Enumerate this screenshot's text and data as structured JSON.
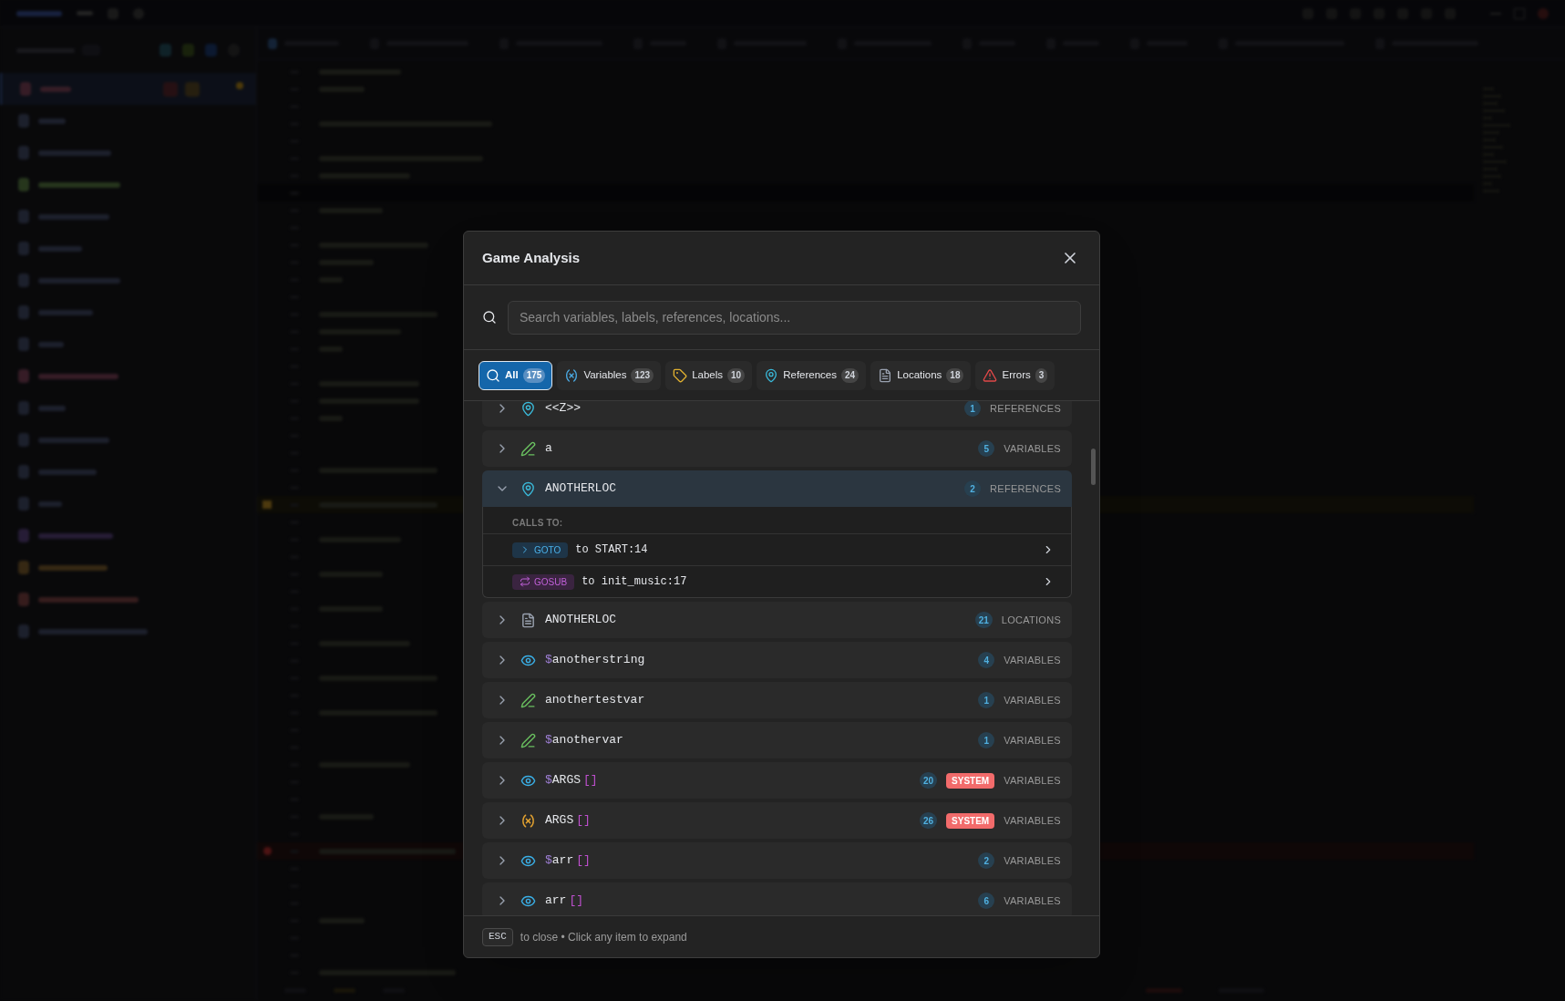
{
  "modal": {
    "title": "Game Analysis",
    "search": {
      "placeholder": "Search variables, labels, references, locations..."
    },
    "filters": [
      {
        "kind": "all",
        "label": "All",
        "count": "175",
        "selected": true
      },
      {
        "kind": "variables",
        "label": "Variables",
        "count": "123",
        "selected": false
      },
      {
        "kind": "labels",
        "label": "Labels",
        "count": "10",
        "selected": false
      },
      {
        "kind": "references",
        "label": "References",
        "count": "24",
        "selected": false
      },
      {
        "kind": "locations",
        "label": "Locations",
        "count": "18",
        "selected": false
      },
      {
        "kind": "errors",
        "label": "Errors",
        "count": "3",
        "selected": false
      }
    ],
    "items": [
      {
        "kind": "reference",
        "name": "<<Z>>",
        "count": "1",
        "category": "REFERENCES",
        "expanded": false
      },
      {
        "kind": "assigned",
        "name": "a",
        "count": "5",
        "category": "VARIABLES",
        "expanded": false
      },
      {
        "kind": "reference",
        "name": "ANOTHERLOC",
        "count": "2",
        "category": "REFERENCES",
        "expanded": true,
        "calls_label": "CALLS TO:",
        "calls": [
          {
            "kind": "goto",
            "tag": "GOTO",
            "target": "to START:14"
          },
          {
            "kind": "gosub",
            "tag": "GOSUB",
            "target": "to init_music:17"
          }
        ]
      },
      {
        "kind": "location",
        "name": "ANOTHERLOC",
        "count": "21",
        "category": "LOCATIONS",
        "expanded": false
      },
      {
        "kind": "read",
        "prefix": "$",
        "name": "anotherstring",
        "count": "4",
        "category": "VARIABLES",
        "expanded": false
      },
      {
        "kind": "assigned",
        "name": "anothertestvar",
        "count": "1",
        "category": "VARIABLES",
        "expanded": false
      },
      {
        "kind": "assigned",
        "prefix": "$",
        "name": "anothervar",
        "count": "1",
        "category": "VARIABLES",
        "expanded": false
      },
      {
        "kind": "read",
        "prefix": "$",
        "name": "ARGS",
        "brackets": "[]",
        "count": "20",
        "badge": "SYSTEM",
        "category": "VARIABLES",
        "expanded": false
      },
      {
        "kind": "variable",
        "name": "ARGS",
        "brackets": "[]",
        "count": "26",
        "badge": "SYSTEM",
        "category": "VARIABLES",
        "expanded": false
      },
      {
        "kind": "read",
        "prefix": "$",
        "name": "arr",
        "brackets": "[]",
        "count": "2",
        "category": "VARIABLES",
        "expanded": false
      },
      {
        "kind": "read",
        "name": "arr",
        "brackets": "[]",
        "count": "6",
        "category": "VARIABLES",
        "expanded": false
      }
    ],
    "footer": {
      "key": "ESC",
      "text": "to close • Click any item to expand"
    }
  }
}
